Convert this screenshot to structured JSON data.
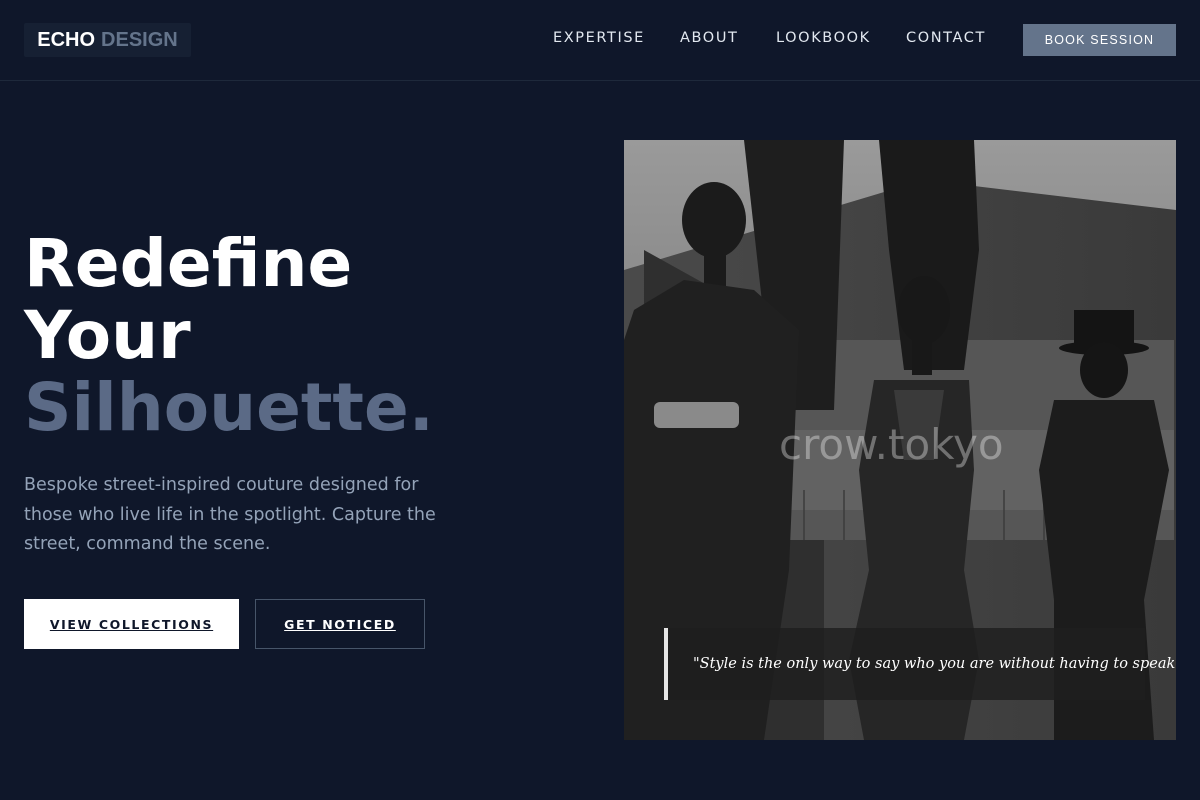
{
  "brand": {
    "part1": "ECHO",
    "part2": "DESIGN"
  },
  "nav": {
    "items": [
      "EXPERTISE",
      "ABOUT",
      "LOOKBOOK",
      "CONTACT"
    ],
    "cta": "BOOK SESSION"
  },
  "hero": {
    "title_line1": "Redefine",
    "title_line2": "Your",
    "title_line3": "Silhouette.",
    "subtitle": "Bespoke street-inspired couture designed for those who live life in the spotlight. Capture the street, command the scene.",
    "primary_cta": "VIEW COLLECTIONS",
    "secondary_cta": "GET NOTICED"
  },
  "image": {
    "watermark": "crow.tokyo",
    "quote": "\"Style is the only way to say who you are without having to speak.\""
  },
  "colors": {
    "background": "#0f172a",
    "accent": "#64748b",
    "text": "#ffffff",
    "muted": "#94a3b8"
  }
}
